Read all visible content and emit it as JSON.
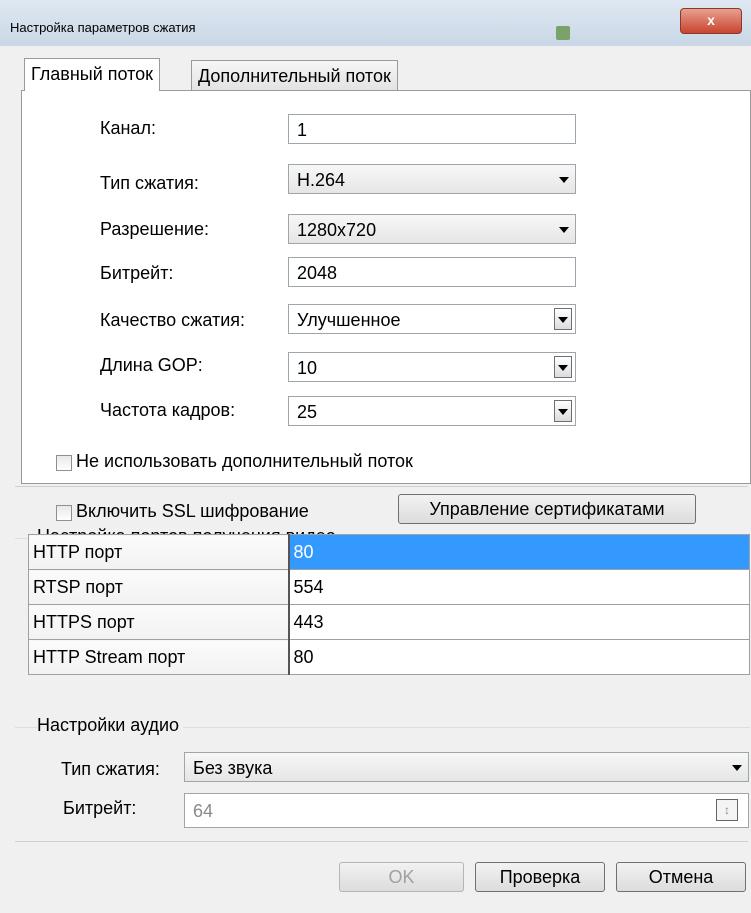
{
  "window": {
    "title": "Настройка параметров сжатия",
    "close_label": "x"
  },
  "tabs": [
    {
      "label": "Главный поток"
    },
    {
      "label": "Дополнительный поток"
    }
  ],
  "main": {
    "channel": {
      "label": "Канал:",
      "value": "1"
    },
    "compression_type": {
      "label": "Тип сжатия:",
      "value": "H.264"
    },
    "resolution": {
      "label": "Разрешение:",
      "value": "1280x720"
    },
    "bitrate": {
      "label": "Битрейт:",
      "value": "2048"
    },
    "quality": {
      "label": "Качество сжатия:",
      "value": "Улучшенное"
    },
    "gop": {
      "label": "Длина GOP:",
      "value": "10"
    },
    "framerate": {
      "label": "Частота кадров:",
      "value": "25"
    },
    "no_sub_stream_label": "Не использовать дополнительный поток"
  },
  "ssl": {
    "label": "Включить SSL шифрование",
    "certs_button": "Управление сертификатами"
  },
  "ports": {
    "title": "Настройка портов получения видео",
    "rows": [
      {
        "name": "HTTP порт",
        "value": "80"
      },
      {
        "name": "RTSP порт",
        "value": "554"
      },
      {
        "name": "HTTPS порт",
        "value": "443"
      },
      {
        "name": "HTTP Stream порт",
        "value": "80"
      }
    ]
  },
  "audio": {
    "title": "Настройки аудио",
    "compression_type": {
      "label": "Тип сжатия:",
      "value": "Без звука"
    },
    "bitrate": {
      "label": "Битрейт:",
      "value": "64"
    }
  },
  "buttons": {
    "ok": "OK",
    "test": "Проверка",
    "cancel": "Отмена"
  },
  "colors": {
    "selection": "#3399ff",
    "close_button": "#c8442f"
  }
}
